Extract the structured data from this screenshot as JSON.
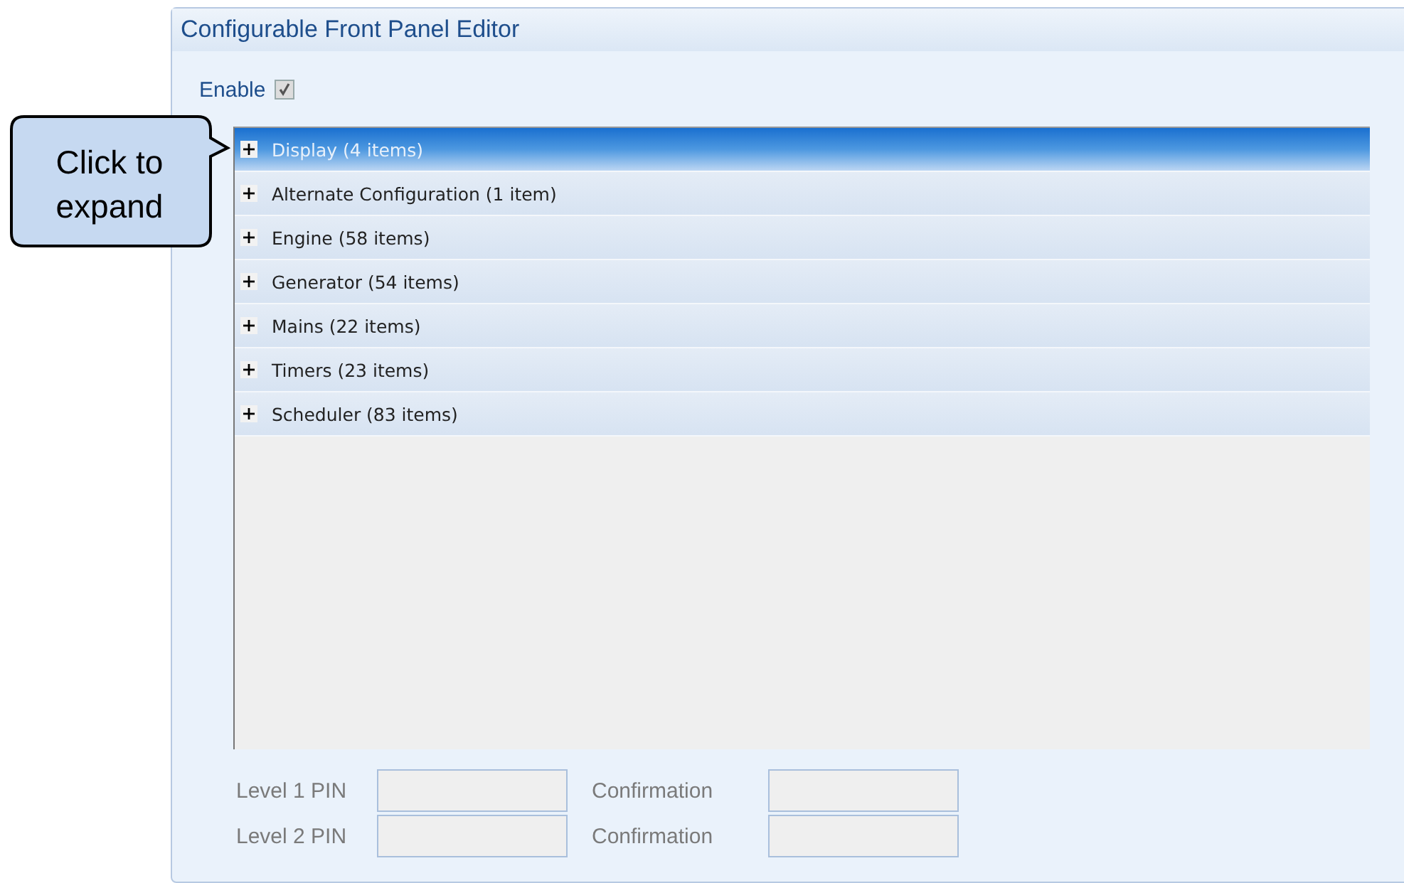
{
  "panel": {
    "title": "Configurable Front Panel Editor",
    "enable": {
      "label": "Enable",
      "checked": true
    }
  },
  "groups": [
    {
      "label": "Display (4 items)",
      "expanded": false,
      "selected": true
    },
    {
      "label": "Alternate Configuration (1 item)",
      "expanded": false,
      "selected": false
    },
    {
      "label": "Engine (58 items)",
      "expanded": false,
      "selected": false
    },
    {
      "label": "Generator (54 items)",
      "expanded": false,
      "selected": false
    },
    {
      "label": "Mains (22 items)",
      "expanded": false,
      "selected": false
    },
    {
      "label": "Timers (23 items)",
      "expanded": false,
      "selected": false
    },
    {
      "label": "Scheduler (83 items)",
      "expanded": false,
      "selected": false
    }
  ],
  "pins": [
    {
      "label": "Level 1 PIN",
      "confirm_label": "Confirmation",
      "disabled": true
    },
    {
      "label": "Level 2 PIN",
      "confirm_label": "Confirmation",
      "disabled": true
    }
  ],
  "callout": {
    "text": "Click to expand"
  }
}
